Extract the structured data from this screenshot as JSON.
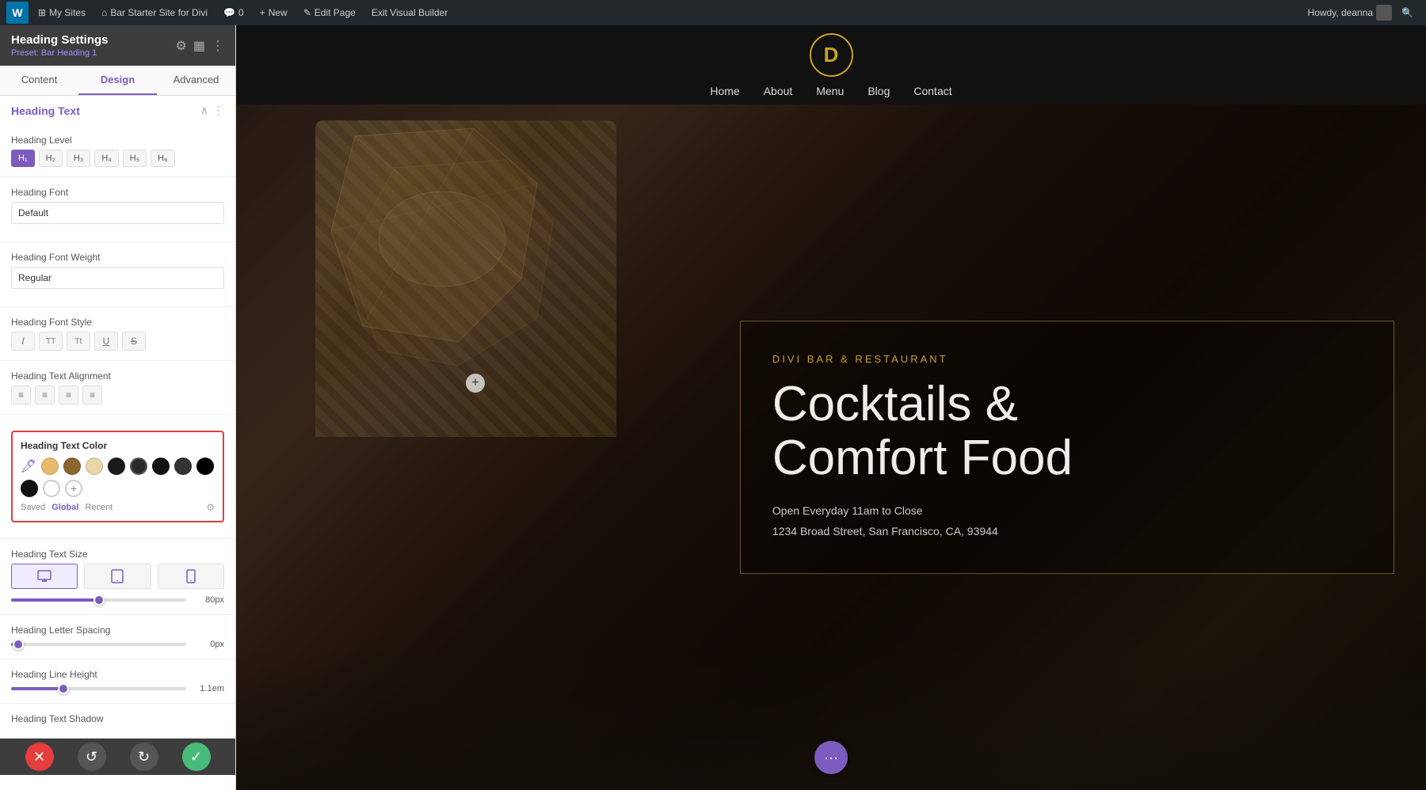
{
  "admin_bar": {
    "wp_icon": "W",
    "items": [
      {
        "label": "My Sites",
        "icon": "⊞"
      },
      {
        "label": "Bar Starter Site for Divi",
        "icon": "⌂"
      },
      {
        "label": "0",
        "icon": "💬"
      },
      {
        "label": "New",
        "icon": "+"
      },
      {
        "label": "Edit Page",
        "icon": "✎"
      },
      {
        "label": "Exit Visual Builder",
        "icon": ""
      }
    ],
    "right": "Howdy, deanna"
  },
  "panel": {
    "title": "Heading Settings",
    "preset": "Preset: Bar Heading 1",
    "tabs": [
      {
        "label": "Content",
        "active": false
      },
      {
        "label": "Design",
        "active": true
      },
      {
        "label": "Advanced",
        "active": false
      }
    ],
    "section_title": "Heading Text",
    "heading_level": {
      "label": "Heading Level",
      "levels": [
        "H1",
        "H2",
        "H3",
        "H4",
        "H5",
        "H6"
      ],
      "active": "H1"
    },
    "heading_font": {
      "label": "Heading Font",
      "value": "Default"
    },
    "heading_font_weight": {
      "label": "Heading Font Weight",
      "value": "Regular"
    },
    "heading_font_style": {
      "label": "Heading Font Style",
      "buttons": [
        "I",
        "TT",
        "Tt",
        "U",
        "S"
      ]
    },
    "heading_text_alignment": {
      "label": "Heading Text Alignment",
      "buttons": [
        "left",
        "center",
        "right",
        "justify"
      ]
    },
    "heading_text_color": {
      "label": "Heading Text Color",
      "swatches": [
        {
          "color": "#e8b86d",
          "type": "filled"
        },
        {
          "color": "#8b6430",
          "type": "filled"
        },
        {
          "color": "#e8d5a8",
          "type": "filled"
        },
        {
          "color": "#1a1a1a",
          "type": "filled"
        },
        {
          "color": "#2a2a2a",
          "type": "filled"
        },
        {
          "color": "#111111",
          "type": "filled"
        },
        {
          "color": "#333333",
          "type": "filled"
        },
        {
          "color": "#1a1a1a",
          "type": "filled"
        },
        {
          "color": "#f0f0f0",
          "type": "outline"
        }
      ],
      "tabs": [
        "Saved",
        "Global",
        "Recent"
      ],
      "active_tab": "Global"
    },
    "heading_text_size": {
      "label": "Heading Text Size",
      "devices": [
        "desktop",
        "tablet",
        "mobile"
      ],
      "active_device": "desktop",
      "value": "80px"
    },
    "heading_letter_spacing": {
      "label": "Heading Letter Spacing",
      "value": "0px",
      "slider_percent": 5
    },
    "heading_line_height": {
      "label": "Heading Line Height",
      "value": "1.1em",
      "slider_percent": 30
    },
    "heading_text_shadow": {
      "label": "Heading Text Shadow"
    }
  },
  "bottom_bar": {
    "cancel_label": "✕",
    "undo_label": "↺",
    "redo_label": "↻",
    "confirm_label": "✓"
  },
  "website": {
    "logo": "D",
    "nav_links": [
      "Home",
      "About",
      "Menu",
      "Blog",
      "Contact"
    ],
    "hero": {
      "subtitle": "DIVI BAR & RESTAURANT",
      "title": "Cocktails &\nComfort Food",
      "address_line1": "Open Everyday 11am to Close",
      "address_line2": "1234 Broad Street, San Francisco, CA, 93944"
    }
  }
}
